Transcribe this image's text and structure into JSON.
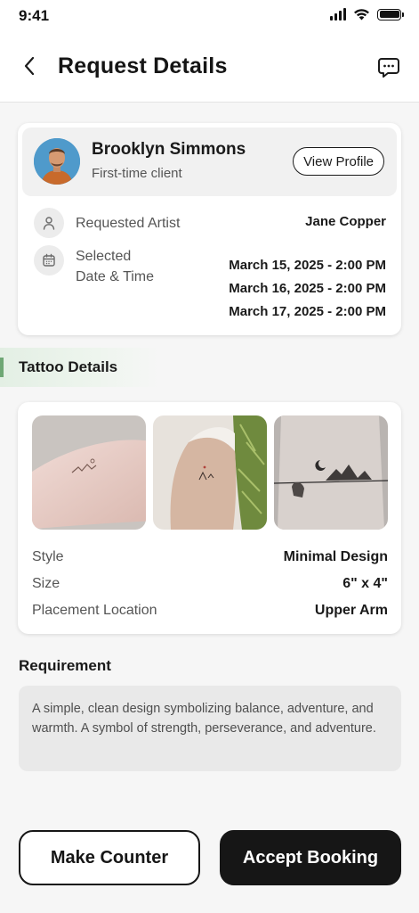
{
  "status_bar": {
    "time": "9:41"
  },
  "header": {
    "title": "Request Details"
  },
  "client": {
    "name": "Brooklyn Simmons",
    "subtitle": "First-time client",
    "view_profile_label": "View Profile"
  },
  "request": {
    "artist_label": "Requested Artist",
    "artist_value": "Jane Copper",
    "datetime_label_line1": "Selected",
    "datetime_label_line2": "Date & Time",
    "dates": [
      "March 15, 2025 - 2:00 PM",
      "March 16, 2025 - 2:00 PM",
      "March 17, 2025 - 2:00 PM"
    ]
  },
  "tattoo": {
    "section_title": "Tattoo Details",
    "details": [
      {
        "label": "Style",
        "value": "Minimal Design"
      },
      {
        "label": "Size",
        "value": "6\" x 4\""
      },
      {
        "label": "Placement Location",
        "value": "Upper Arm"
      }
    ]
  },
  "requirement": {
    "title": "Requirement",
    "text": "A simple, clean design symbolizing balance, adventure, and warmth. A symbol of strength, perseverance, and adventure."
  },
  "actions": {
    "counter_label": "Make Counter",
    "accept_label": "Accept Booking"
  },
  "icons": {
    "back": "chevron-left-icon",
    "chat": "chat-bubble-icon",
    "artist": "user-icon",
    "calendar": "calendar-icon"
  },
  "colors": {
    "accent_green": "#6fa775",
    "primary_dark": "#161616",
    "background": "#f6f6f6"
  }
}
